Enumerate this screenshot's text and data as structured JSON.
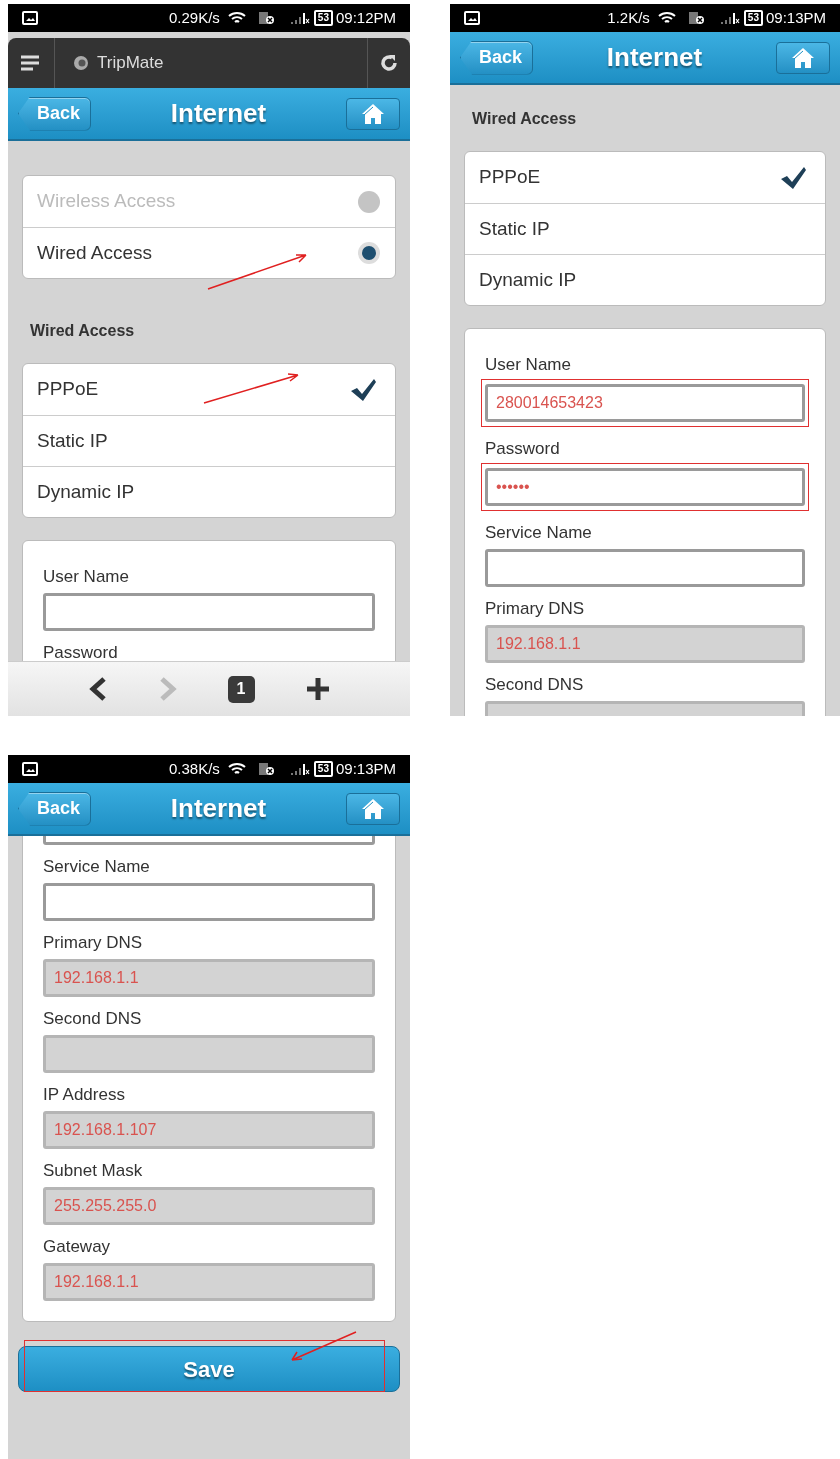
{
  "screens": [
    {
      "status_bar": {
        "speed": "0.29K/s",
        "battery": "53",
        "time": "09:12PM"
      },
      "browser_bar": {
        "title": "TripMate"
      },
      "nav": {
        "back": "Back",
        "title": "Internet"
      },
      "access_options": [
        {
          "label": "Wireless Access",
          "disabled": true,
          "selected": false,
          "pointed": false
        },
        {
          "label": "Wired Access",
          "disabled": false,
          "selected": true,
          "pointed": true
        }
      ],
      "section_title": "Wired Access",
      "connection_types": [
        {
          "label": "PPPoE",
          "selected": true,
          "pointed": true
        },
        {
          "label": "Static IP",
          "selected": false,
          "pointed": false
        },
        {
          "label": "Dynamic IP",
          "selected": false,
          "pointed": false
        }
      ],
      "fields": [
        {
          "kind": "field",
          "label": "User Name",
          "disabled": false,
          "highlighted": false
        },
        {
          "kind": "label",
          "label": "Password"
        }
      ],
      "toolbar": {
        "tab_count": "1"
      }
    },
    {
      "status_bar": {
        "speed": "1.2K/s",
        "battery": "53",
        "time": "09:13PM"
      },
      "nav": {
        "back": "Back",
        "title": "Internet"
      },
      "section_title": "Wired Access",
      "connection_types": [
        {
          "label": "PPPoE",
          "selected": true,
          "pointed": false
        },
        {
          "label": "Static IP",
          "selected": false,
          "pointed": false
        },
        {
          "label": "Dynamic IP",
          "selected": false,
          "pointed": false
        }
      ],
      "fields": [
        {
          "kind": "field",
          "label": "User Name",
          "value": "280014653423",
          "disabled": false,
          "highlighted": true
        },
        {
          "kind": "field",
          "label": "Password",
          "value": "••••••",
          "disabled": false,
          "highlighted": true
        },
        {
          "kind": "field",
          "label": "Service Name",
          "disabled": false,
          "highlighted": false
        },
        {
          "kind": "field",
          "label": "Primary DNS",
          "value": "192.168.1.1",
          "disabled": true,
          "highlighted": false
        },
        {
          "kind": "field",
          "label": "Second DNS",
          "disabled": true,
          "highlighted": false
        }
      ]
    },
    {
      "status_bar": {
        "speed": "0.38K/s",
        "battery": "53",
        "time": "09:13PM"
      },
      "nav": {
        "back": "Back",
        "title": "Internet"
      },
      "fields": [
        {
          "kind": "cut",
          "disabled": false,
          "highlighted": false
        },
        {
          "kind": "field",
          "label": "Service Name",
          "disabled": false,
          "highlighted": false
        },
        {
          "kind": "field",
          "label": "Primary DNS",
          "value": "192.168.1.1",
          "disabled": true,
          "highlighted": false
        },
        {
          "kind": "field",
          "label": "Second DNS",
          "disabled": true,
          "highlighted": false
        },
        {
          "kind": "field",
          "label": "IP Address",
          "value": "192.168.1.107",
          "disabled": true,
          "highlighted": false
        },
        {
          "kind": "field",
          "label": "Subnet Mask",
          "value": "255.255.255.0",
          "disabled": true,
          "highlighted": false
        },
        {
          "kind": "field",
          "label": "Gateway",
          "value": "192.168.1.1",
          "disabled": true,
          "highlighted": false
        }
      ],
      "save_button": {
        "label": "Save",
        "highlighted": true,
        "pointed": true
      }
    }
  ]
}
